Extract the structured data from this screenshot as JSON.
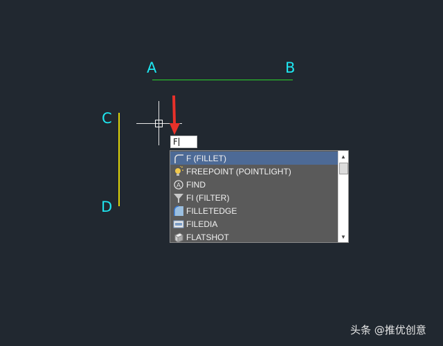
{
  "drawing": {
    "labels": {
      "a": "A",
      "b": "B",
      "c": "C",
      "d": "D"
    },
    "colors": {
      "background": "#212830",
      "label": "#1ee6f0",
      "line_ab": "#2bd62b",
      "line_cd": "#e0d60a",
      "arrow": "#e8312a"
    }
  },
  "command_input": {
    "value": "F"
  },
  "autocomplete": {
    "items": [
      {
        "label": "F (FILLET)",
        "icon": "fillet-icon",
        "selected": true
      },
      {
        "label": "FREEPOINT (POINTLIGHT)",
        "icon": "pointlight-icon",
        "selected": false
      },
      {
        "label": "FIND",
        "icon": "find-icon",
        "selected": false
      },
      {
        "label": "FI (FILTER)",
        "icon": "filter-icon",
        "selected": false
      },
      {
        "label": "FILLETEDGE",
        "icon": "filletedge-icon",
        "selected": false
      },
      {
        "label": "FILEDIA",
        "icon": "filedia-icon",
        "selected": false
      },
      {
        "label": "FLATSHOT",
        "icon": "flatshot-icon",
        "selected": false
      }
    ]
  },
  "watermark": {
    "text": "头条 @推优创意"
  }
}
